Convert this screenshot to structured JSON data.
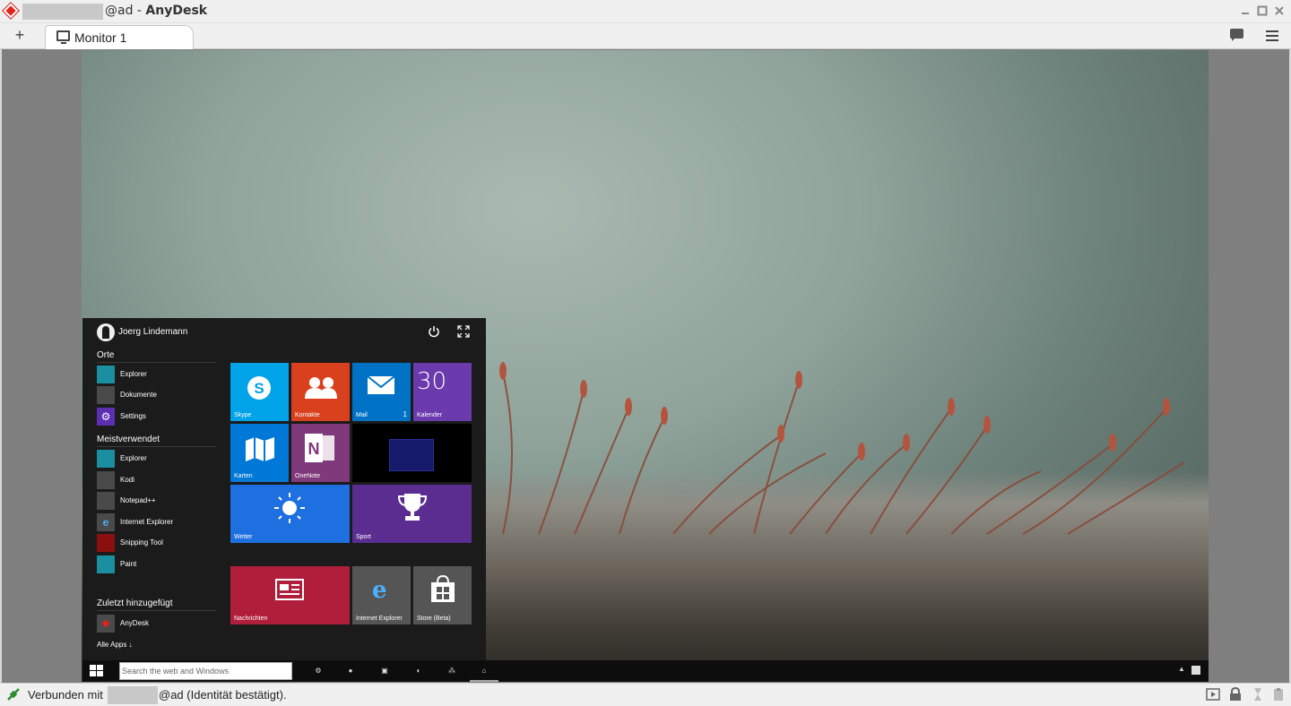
{
  "window": {
    "title_suffix": "@ad",
    "title_separator": " - ",
    "app_name": "AnyDesk",
    "controls": [
      "minimize",
      "maximize",
      "close"
    ]
  },
  "tabs": {
    "add_label": "+",
    "items": [
      {
        "label": "Monitor 1",
        "icon": "monitor-icon"
      }
    ]
  },
  "toolbar": {
    "icons": [
      "chat-icon",
      "menu-icon"
    ]
  },
  "start_menu": {
    "user": "Joerg Lindemann",
    "sections": {
      "places": "Orte",
      "most_used": "Meistverwendet",
      "recent": "Zuletzt hinzugefügt"
    },
    "places_items": [
      {
        "label": "Explorer",
        "color": "#1a8fa0"
      },
      {
        "label": "Dokumente",
        "color": "#4a4a4a"
      },
      {
        "label": "Settings",
        "color": "#5b2fb0"
      }
    ],
    "most_used_items": [
      {
        "label": "Explorer",
        "color": "#1a8fa0"
      },
      {
        "label": "Kodi",
        "color": "#4a4a4a"
      },
      {
        "label": "Notepad++",
        "color": "#4a4a4a"
      },
      {
        "label": "Internet Explorer",
        "color": "#4a4a4a"
      },
      {
        "label": "Snipping Tool",
        "color": "#8a1010"
      },
      {
        "label": "Paint",
        "color": "#1a8fa0"
      }
    ],
    "recent_items": [
      {
        "label": "AnyDesk",
        "color": "#4a4a4a"
      }
    ],
    "all_apps": "Alle Apps ↓",
    "tiles": {
      "skype": {
        "label": "Skype",
        "color": "#00a2e8"
      },
      "kontakte": {
        "label": "Kontakte",
        "color": "#d9411e"
      },
      "mail": {
        "label": "Mail",
        "badge": "1",
        "color": "#0072c6"
      },
      "kalender": {
        "label": "Kalender",
        "date": "30",
        "color": "#6b3aad"
      },
      "karten": {
        "label": "Karten",
        "color": "#0078d7"
      },
      "onenote": {
        "label": "OneNote",
        "color": "#80397b"
      },
      "wetter": {
        "label": "Wetter",
        "color": "#1e6fe0"
      },
      "sport": {
        "label": "Sport",
        "color": "#5c2d91"
      },
      "nachrichten": {
        "label": "Nachrichten",
        "color": "#b01e3c"
      },
      "ie": {
        "label": "Internet Explorer",
        "color": "#555555"
      },
      "store": {
        "label": "Store (Beta)",
        "color": "#555555"
      }
    }
  },
  "taskbar": {
    "search_placeholder": "Search the web and Windows"
  },
  "status": {
    "prefix": "Verbunden mit",
    "suffix": "@ad (Identität bestätigt)."
  }
}
